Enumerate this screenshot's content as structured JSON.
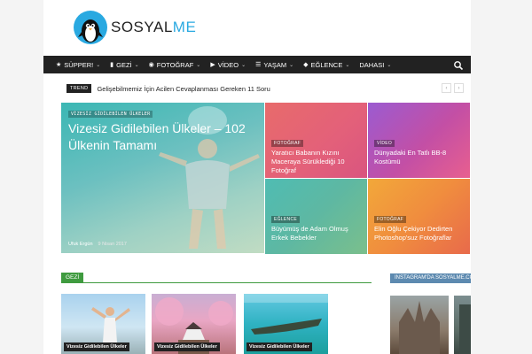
{
  "header": {
    "logo_text_a": "SOSYAL",
    "logo_text_b": "ME"
  },
  "nav": {
    "items": [
      {
        "icon": "★",
        "label": "SÜPPER!"
      },
      {
        "icon": "▮",
        "label": "GEZİ"
      },
      {
        "icon": "◉",
        "label": "FOTOĞRAF"
      },
      {
        "icon": "▶",
        "label": "VİDEO"
      },
      {
        "icon": "☰",
        "label": "YAŞAM"
      },
      {
        "icon": "◆",
        "label": "EĞLENCE"
      },
      {
        "icon": "",
        "label": "DAHASI"
      }
    ]
  },
  "trending": {
    "badge": "TREND",
    "headline": "Gelişebilmemiz İçin Acilen Cevaplanması Gereken 11 Soru",
    "prev": "‹",
    "next": "›"
  },
  "featured": [
    {
      "category": "VİZESİZ GİDİLEBİLEN ÜLKELER",
      "title": "Vizesiz Gidilebilen Ülkeler – 102 Ülkenin Tamamı",
      "author": "Ufuk Ergün",
      "date": "9 Nisan 2017"
    },
    {
      "category": "FOTOĞRAF",
      "title": "Yaratıcı Babanın Kızını Maceraya Sürüklediği 10 Fotoğraf"
    },
    {
      "category": "VİDEO",
      "title": "Dünyadaki En Tatlı BB-8 Kostümü"
    },
    {
      "category": "EĞLENCE",
      "title": "Büyümüş de Adam Olmuş Erkek Bebekler"
    },
    {
      "category": "FOTOĞRAF",
      "title": "Elin Oğlu Çekiyor Dedirten Photoshop'suz Fotoğraflar"
    }
  ],
  "sections": {
    "gezi": "GEZİ",
    "instagram": "INSTAGRAM'DA SOSYALME.COM"
  },
  "cards": [
    {
      "category": "Vizesiz Gidilebilen Ülkeler"
    },
    {
      "category": "Vizesiz Gidilebilen Ülkeler"
    },
    {
      "category": "Vizesiz Gidilebilen Ülkeler"
    }
  ]
}
